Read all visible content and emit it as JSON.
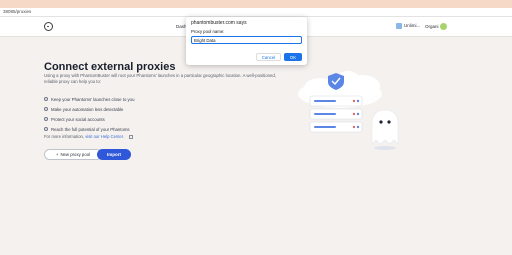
{
  "browser": {
    "url": "38085/proxies"
  },
  "navbar": {
    "items": [
      {
        "label": "Dash"
      }
    ],
    "credits": "Unlimi...",
    "org": "Organi"
  },
  "page": {
    "title": "Connect external proxies",
    "description": "Using a proxy with PhantomBuster will root your Phantoms' launches in a particular geographic location. A well-positioned, reliable proxy can help you to:",
    "benefits": [
      "Keep your Phantoms' launches close to you",
      "Make your automation less detectable",
      "Protect your social accounts",
      "Reach the full potential of your Phantoms"
    ],
    "more_info_prefix": "For more information,",
    "more_info_link": "visit our Help Center.",
    "new_proxy_button": "New proxy pool",
    "import_button": "Import"
  },
  "dialog": {
    "title": "phantombuster.com says",
    "label": "Proxy pool name:",
    "input_value": "Bright Data",
    "cancel_label": "Cancel",
    "ok_label": "OK"
  },
  "colors": {
    "accent": "#2f57d9",
    "dialog_ok": "#1a73e8",
    "background": "#f4f1ee"
  }
}
